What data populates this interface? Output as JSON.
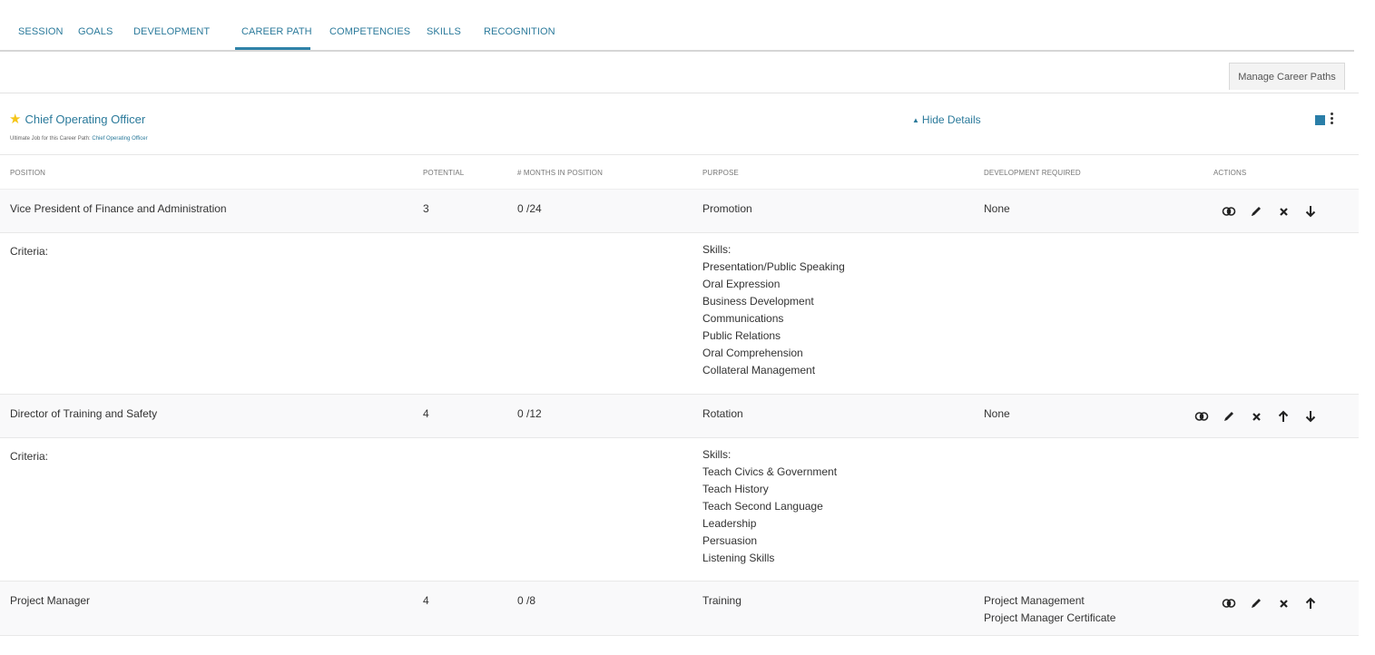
{
  "tabs": [
    {
      "label": "SESSION",
      "active": false
    },
    {
      "label": "GOALS",
      "active": false
    },
    {
      "label": "DEVELOPMENT",
      "active": false
    },
    {
      "label": "CAREER PATH",
      "active": true
    },
    {
      "label": "COMPETENCIES",
      "active": false
    },
    {
      "label": "SKILLS",
      "active": false
    },
    {
      "label": "RECOGNITION",
      "active": false
    }
  ],
  "toolbar": {
    "manage_label": "Manage Career Paths"
  },
  "career_path": {
    "title": "Chief Operating Officer",
    "subtitle_prefix": "Ultimate Job for this Career Path: ",
    "subtitle_link": "Chief Operating Officer",
    "hide_details_label": "Hide Details",
    "accent_color": "#2a7ea8",
    "star_color": "#f5c518"
  },
  "table": {
    "headers": {
      "position": "POSITION",
      "potential": "POTENTIAL",
      "months": "# MONTHS IN POSITION",
      "purpose": "PURPOSE",
      "development": "DEVELOPMENT REQUIRED",
      "actions": "ACTIONS"
    },
    "criteria_label": "Criteria:",
    "rows": [
      {
        "position": "Vice President of Finance and Administration",
        "potential": "3",
        "months": "0 /24",
        "purpose": "Promotion",
        "development": [
          "None"
        ],
        "actions": [
          "view",
          "edit",
          "delete",
          "move-down"
        ],
        "skills_label": "Skills:",
        "skills": [
          "Presentation/Public Speaking",
          "Oral Expression",
          "Business Development",
          "Communications",
          "Public Relations",
          "Oral Comprehension",
          "Collateral Management"
        ]
      },
      {
        "position": "Director of Training and Safety",
        "potential": "4",
        "months": "0 /12",
        "purpose": "Rotation",
        "development": [
          "None"
        ],
        "actions": [
          "view",
          "edit",
          "delete",
          "move-up",
          "move-down"
        ],
        "skills_label": "Skills:",
        "skills": [
          "Teach Civics & Government",
          "Teach History",
          "Teach Second Language",
          "Leadership",
          "Persuasion",
          "Listening Skills"
        ]
      },
      {
        "position": "Project Manager",
        "potential": "4",
        "months": "0 /8",
        "purpose": "Training",
        "development": [
          "Project Management",
          "Project Manager Certificate"
        ],
        "actions": [
          "view",
          "edit",
          "delete",
          "move-up"
        ]
      }
    ]
  }
}
